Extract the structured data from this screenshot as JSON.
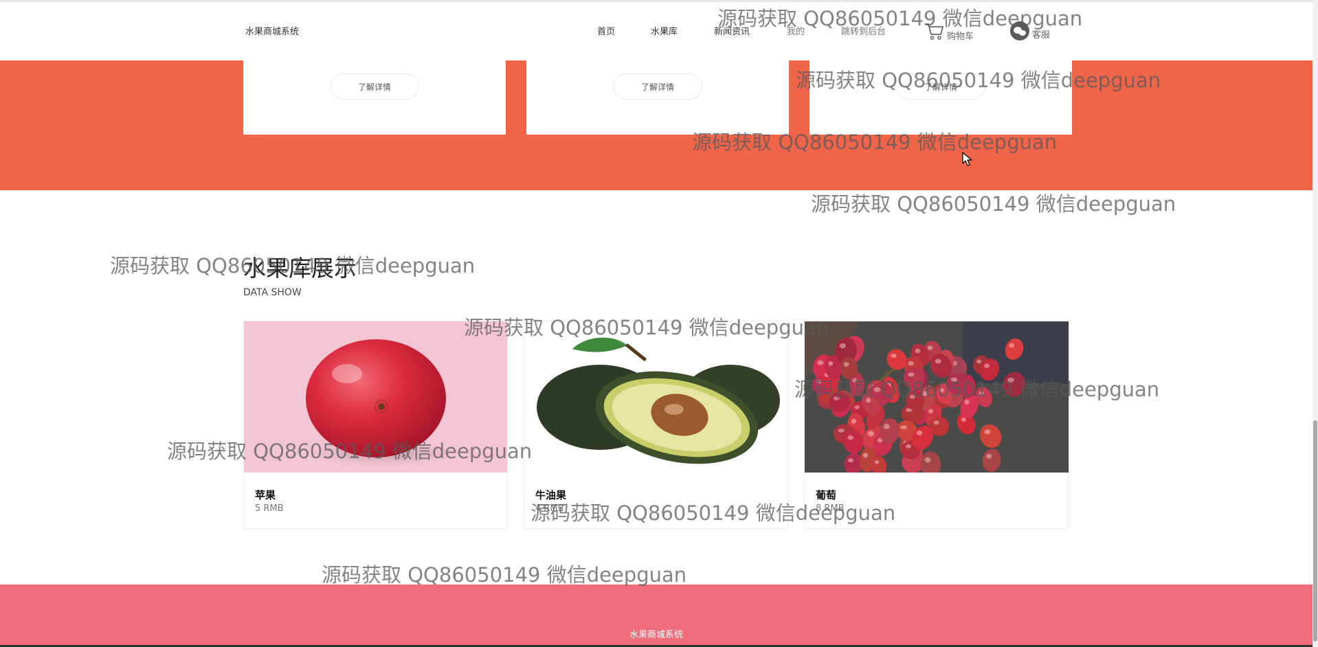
{
  "navbar": {
    "brand": "水果商城系统",
    "items": [
      {
        "label": "首页"
      },
      {
        "label": "水果库"
      },
      {
        "label": "新闻资讯"
      },
      {
        "label": "我的"
      },
      {
        "label": "跳转到后台"
      }
    ],
    "cart_label": "购物车",
    "service_label": "客服"
  },
  "top_cards": [
    {
      "button_label": "了解详情"
    },
    {
      "button_label": "了解详情"
    },
    {
      "button_label": "了解详情"
    }
  ],
  "section": {
    "title": "水果库展示",
    "subtitle": "DATA SHOW"
  },
  "products": [
    {
      "name": "苹果",
      "price": "5 RMB"
    },
    {
      "name": "牛油果",
      "price": "4 RMB"
    },
    {
      "name": "葡萄",
      "price": "8 RMB"
    }
  ],
  "footer": {
    "text": "水果商城系统"
  },
  "watermark": "源码获取 QQ86050149 微信deepguan",
  "colors": {
    "orange_band": "#f06449",
    "footer": "#f16d7b"
  }
}
